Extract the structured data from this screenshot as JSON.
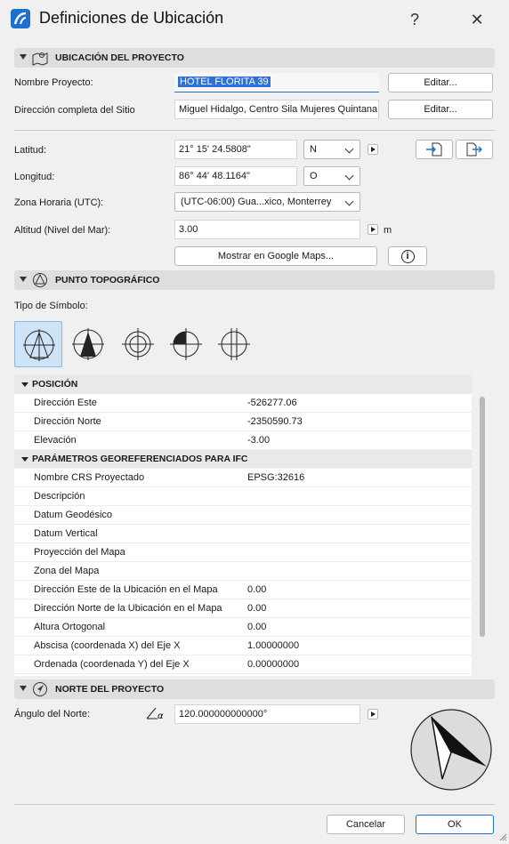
{
  "window": {
    "title": "Definiciones de Ubicación",
    "help_label": "?",
    "close_label": "✕"
  },
  "sec_project": {
    "title": "UBICACIÓN DEL PROYECTO"
  },
  "project_name": {
    "label": "Nombre Proyecto:",
    "value": "HOTEL FLORITA 39",
    "edit_label": "Editar..."
  },
  "site_address": {
    "label": "Dirección completa del Sitio",
    "value": "Miguel Hidalgo, Centro Sila Mujeres Quintana Roo",
    "edit_label": "Editar..."
  },
  "latitude": {
    "label": "Latitud:",
    "value": "21° 15' 24.5808\"",
    "hemisphere": "N"
  },
  "longitude": {
    "label": "Longitud:",
    "value": "86° 44' 48.1164\"",
    "hemisphere": "O"
  },
  "timezone": {
    "label": "Zona Horaria (UTC):",
    "value": "(UTC-06:00) Gua...xico, Monterrey"
  },
  "altitude": {
    "label": "Altitud (Nivel del Mar):",
    "value": "3.00",
    "unit": "m"
  },
  "google_maps_label": "Mostrar en Google Maps...",
  "info_label": "i",
  "sec_survey": {
    "title": "PUNTO TOPOGRÁFICO"
  },
  "symbol_type_label": "Tipo de Símbolo:",
  "symbols": [
    "survey-point-symbol-1",
    "survey-point-symbol-2",
    "survey-point-symbol-3",
    "survey-point-symbol-4",
    "survey-point-symbol-5"
  ],
  "table": {
    "groups": [
      {
        "title": "POSICIÓN",
        "rows": [
          {
            "name": "Dirección Este",
            "value": "-526277.06"
          },
          {
            "name": "Dirección Norte",
            "value": "-2350590.73"
          },
          {
            "name": "Elevación",
            "value": "-3.00"
          }
        ]
      },
      {
        "title": "PARÁMETROS GEOREFERENCIADOS PARA IFC",
        "rows": [
          {
            "name": "Nombre CRS Proyectado",
            "value": "EPSG:32616"
          },
          {
            "name": "Descripción",
            "value": ""
          },
          {
            "name": "Datum Geodésico",
            "value": ""
          },
          {
            "name": "Datum Vertical",
            "value": ""
          },
          {
            "name": "Proyección del Mapa",
            "value": ""
          },
          {
            "name": "Zona del Mapa",
            "value": ""
          },
          {
            "name": "Dirección Este de la Ubicación en el Mapa",
            "value": "0.00"
          },
          {
            "name": "Dirección Norte de la Ubicación en el Mapa",
            "value": "0.00"
          },
          {
            "name": "Altura Ortogonal",
            "value": "0.00"
          },
          {
            "name": "Abscisa (coordenada X) del Eje X",
            "value": "1.00000000"
          },
          {
            "name": "Ordenada (coordenada Y) del Eje X",
            "value": "0.00000000"
          }
        ]
      }
    ]
  },
  "sec_north": {
    "title": "NORTE DEL PROYECTO"
  },
  "north_angle": {
    "label": "Ángulo del Norte:",
    "value": "120.000000000000°"
  },
  "footer": {
    "cancel_label": "Cancelar",
    "ok_label": "OK"
  },
  "colors": {
    "accent": "#1e6fd0",
    "selected": "#cfe3f7"
  }
}
